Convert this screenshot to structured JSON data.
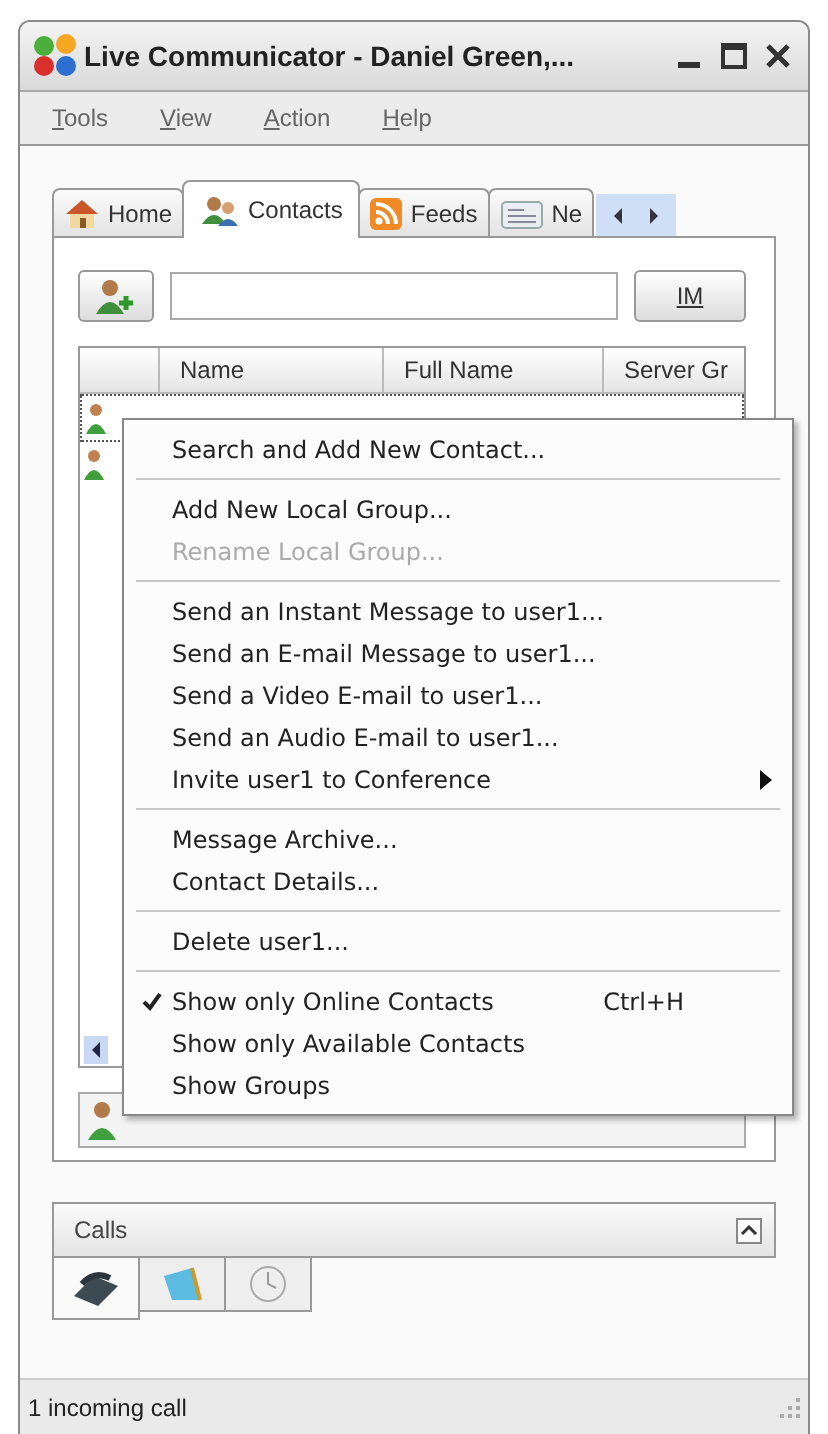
{
  "window": {
    "title": "Live Communicator - Daniel Green,..."
  },
  "menu_bar": [
    "Tools",
    "View",
    "Action",
    "Help"
  ],
  "tabs": [
    {
      "label": "Home",
      "selected": false
    },
    {
      "label": "Contacts",
      "selected": true
    },
    {
      "label": "Feeds",
      "selected": false
    },
    {
      "label": "Ne",
      "selected": false
    }
  ],
  "contacts": {
    "im_button": "IM",
    "table": {
      "columns": [
        "Name",
        "Full Name",
        "Server Gr"
      ]
    }
  },
  "context_menu": [
    {
      "kind": "item",
      "label": "Search and Add New Contact...",
      "disabled": false,
      "checked": false
    },
    {
      "kind": "separator"
    },
    {
      "kind": "item",
      "label": "Add New Local Group...",
      "disabled": false,
      "checked": false
    },
    {
      "kind": "item",
      "label": "Rename Local Group...",
      "disabled": true,
      "checked": false
    },
    {
      "kind": "separator"
    },
    {
      "kind": "item",
      "label": "Send an Instant Message to user1...",
      "disabled": false,
      "checked": false
    },
    {
      "kind": "item",
      "label": "Send an E-mail Message to user1...",
      "disabled": false,
      "checked": false
    },
    {
      "kind": "item",
      "label": "Send a Video E-mail to user1...",
      "disabled": false,
      "checked": false
    },
    {
      "kind": "item",
      "label": "Send an Audio E-mail to user1...",
      "disabled": false,
      "checked": false
    },
    {
      "kind": "submenu",
      "label": "Invite user1 to Conference",
      "disabled": false,
      "checked": false
    },
    {
      "kind": "separator"
    },
    {
      "kind": "item",
      "label": "Message Archive...",
      "disabled": false,
      "checked": false
    },
    {
      "kind": "item",
      "label": "Contact Details...",
      "disabled": false,
      "checked": false
    },
    {
      "kind": "separator"
    },
    {
      "kind": "item",
      "label": "Delete user1...",
      "disabled": false,
      "checked": false
    },
    {
      "kind": "separator"
    },
    {
      "kind": "item",
      "label": "Show only Online Contacts",
      "shortcut": "Ctrl+H",
      "disabled": false,
      "checked": true
    },
    {
      "kind": "item",
      "label": "Show only Available Contacts",
      "disabled": false,
      "checked": false
    },
    {
      "kind": "item",
      "label": "Show Groups",
      "disabled": false,
      "checked": false
    }
  ],
  "calls": {
    "title": "Calls",
    "tabs": [
      {
        "selected": true
      },
      {
        "selected": false
      },
      {
        "selected": false
      }
    ]
  },
  "status_bar": "1 incoming call"
}
